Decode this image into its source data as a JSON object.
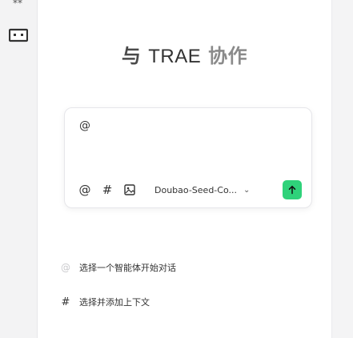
{
  "rail": {
    "top_icon": "sparkle-icon",
    "chat_icon": "chat-window-icon"
  },
  "title": {
    "prefix": "与",
    "brand": "TRAE",
    "suffix": "协作"
  },
  "composer": {
    "input_value": "@",
    "tools": [
      {
        "icon": "at-icon",
        "glyph": "@"
      },
      {
        "icon": "hash-icon",
        "glyph": "#"
      },
      {
        "icon": "image-icon",
        "glyph": ""
      }
    ],
    "model": "Doubao-Seed-Co...",
    "model_chevron": "chevron-down-icon",
    "send_icon": "arrow-up-icon",
    "send_color": "#2fd27a"
  },
  "hints": [
    {
      "icon": "at-icon",
      "glyph": "@",
      "text": "选择一个智能体开始对话"
    },
    {
      "icon": "hash-icon",
      "glyph": "#",
      "text": "选择并添加上下文"
    }
  ]
}
